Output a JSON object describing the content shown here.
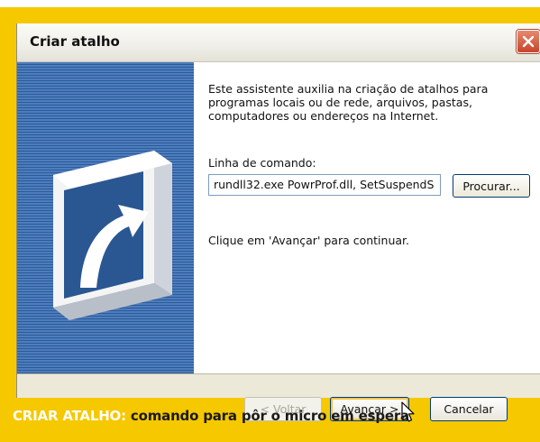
{
  "window": {
    "title": "Criar atalho",
    "close_icon": "close-icon"
  },
  "sidebar": {
    "icon": "shortcut-arrow-icon"
  },
  "content": {
    "intro": "Este assistente auxilia na criação de atalhos para\nprogramas locais ou de rede, arquivos, pastas,\ncomputadores ou endereços na Internet.",
    "command_label": "Linha de comando:",
    "command_value": "rundll32.exe PowrProf.dll, SetSuspendS",
    "browse_label": "Procurar...",
    "hint": "Clique em 'Avançar' para continuar."
  },
  "footer": {
    "back_label": "< Voltar",
    "next_label": "Avançar >",
    "cancel_label": "Cancelar"
  },
  "caption": {
    "keyword": "CRIAR ATALHO:",
    "text": " comando para pôr o micro em espera"
  },
  "colors": {
    "frame": "#f5c800",
    "sidebar": "#2e5d9c",
    "close_button": "#c7442a"
  }
}
